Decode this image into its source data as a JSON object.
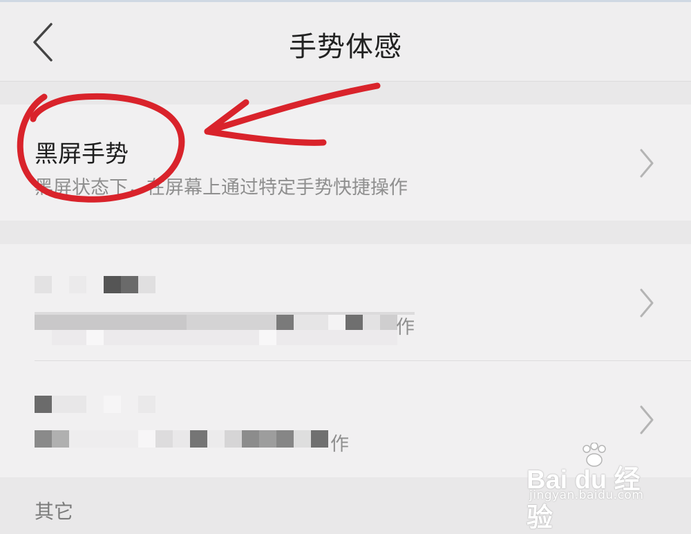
{
  "header": {
    "title": "手势体感",
    "back_icon": "chevron-left-icon"
  },
  "rows": [
    {
      "title": "黑屏手势",
      "subtitle": "黑屏状态下，在屏幕上通过特定手势快捷操作",
      "chevron_icon": "chevron-right-icon"
    },
    {
      "title": "",
      "subtitle": "作",
      "chevron_icon": "chevron-right-icon",
      "obscured": true
    },
    {
      "title": "",
      "subtitle": "作",
      "chevron_icon": "chevron-right-icon",
      "obscured": true
    }
  ],
  "section": {
    "label": "其它"
  },
  "annotation": {
    "color": "#d9232b",
    "shape": "circle-with-arrow"
  },
  "watermark": {
    "logo_text": "Bai du 经验",
    "url": "jingyan.baidu.com"
  },
  "colors": {
    "background": "#e9e8e9",
    "card": "#f1f0f1",
    "subtitle": "#8f8f8f",
    "chevron": "#b4b4b4"
  }
}
